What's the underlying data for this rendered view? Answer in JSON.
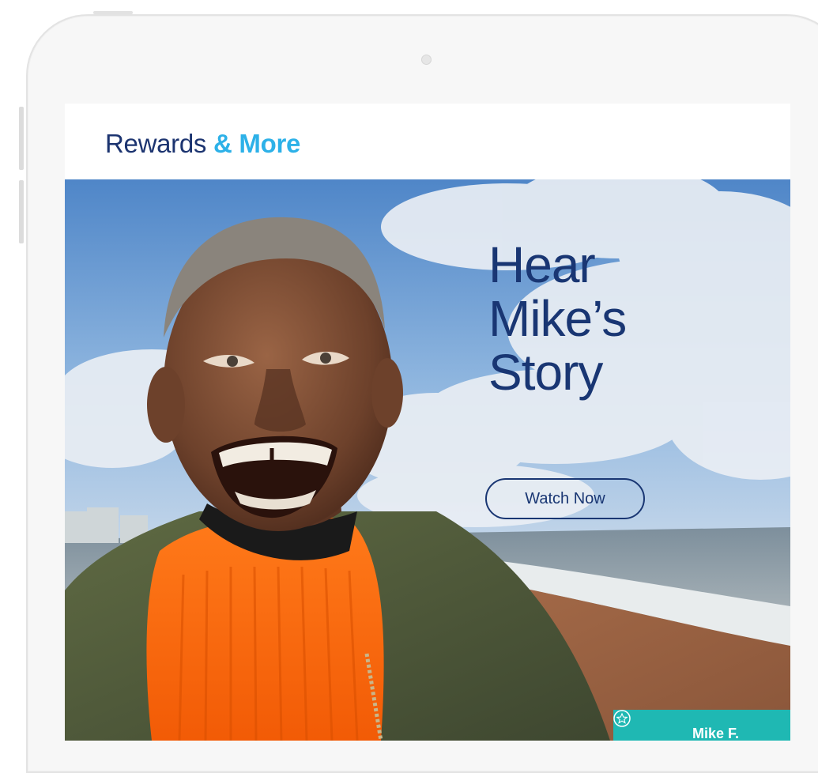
{
  "brand": {
    "word1": "Rewards",
    "word2": "& More"
  },
  "hero": {
    "headline_lines": [
      "Hear",
      "Mike’s",
      "Story"
    ],
    "cta_label": "Watch Now",
    "image_subject": "smiling man on a beach"
  },
  "nametag": {
    "icon": "star-icon",
    "label": "Mike F."
  },
  "colors": {
    "navy": "#193673",
    "brand_blue": "#2db1e8",
    "teal": "#1fb8b3"
  }
}
